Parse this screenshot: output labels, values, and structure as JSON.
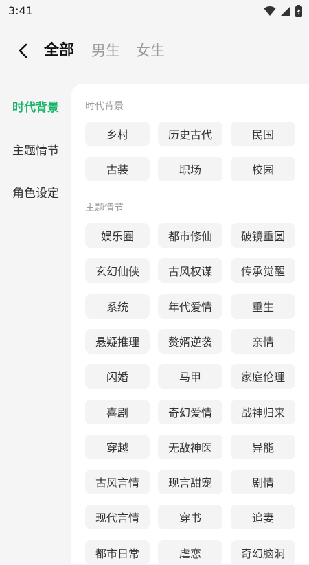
{
  "status_bar": {
    "time": "3:41"
  },
  "header": {
    "tabs": [
      {
        "label": "全部",
        "active": true
      },
      {
        "label": "男生",
        "active": false
      },
      {
        "label": "女生",
        "active": false
      }
    ]
  },
  "sidebar": {
    "items": [
      {
        "label": "时代背景",
        "active": true
      },
      {
        "label": "主题情节",
        "active": false
      },
      {
        "label": "角色设定",
        "active": false
      }
    ]
  },
  "sections": [
    {
      "title": "时代背景",
      "tags": [
        "乡村",
        "历史古代",
        "民国",
        "古装",
        "职场",
        "校园"
      ]
    },
    {
      "title": "主题情节",
      "tags": [
        "娱乐圈",
        "都市修仙",
        "破镜重圆",
        "玄幻仙侠",
        "古风权谋",
        "传承觉醒",
        "系统",
        "年代爱情",
        "重生",
        "悬疑推理",
        "赘婿逆袭",
        "亲情",
        "闪婚",
        "马甲",
        "家庭伦理",
        "喜剧",
        "奇幻爱情",
        "战神归来",
        "穿越",
        "无敌神医",
        "异能",
        "古风言情",
        "现言甜宠",
        "剧情",
        "现代言情",
        "穿书",
        "追妻",
        "都市日常",
        "虐恋",
        "奇幻脑洞"
      ]
    }
  ],
  "colors": {
    "accent": "#19b36b",
    "chip_bg": "#f4f4f4",
    "page_bg": "#f5f5f5"
  }
}
